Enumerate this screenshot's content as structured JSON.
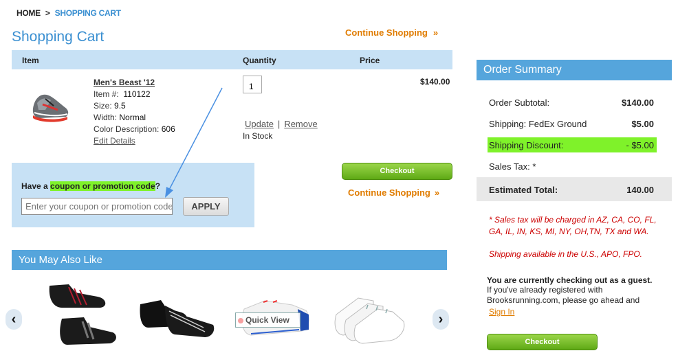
{
  "breadcrumb": {
    "home": "HOME",
    "sep": ">",
    "current": "SHOPPING CART"
  },
  "page": {
    "title": "Shopping Cart",
    "continue_top": "Continue Shopping",
    "arrow": "»"
  },
  "table": {
    "col_item": "Item",
    "col_quantity": "Quantity",
    "col_price": "Price"
  },
  "product": {
    "name": "Men's Beast '12",
    "item_label": "Item #:",
    "item_value": "110122",
    "size_label": "Size:",
    "size_value": "9.5",
    "width_label": "Width:",
    "width_value": "Normal",
    "color_label": "Color Description:",
    "color_value": "606",
    "edit_link": "Edit Details",
    "quantity": "1",
    "update_link": "Update",
    "separator": "|",
    "remove_link": "Remove",
    "stock": "In Stock",
    "price": "$140.00"
  },
  "coupon": {
    "question_prefix": "Have a ",
    "question_highlight": "coupon or promotion code",
    "question_suffix": "?",
    "placeholder": "Enter your coupon or promotion code",
    "apply_label": "APPLY"
  },
  "actions": {
    "checkout_label": "Checkout",
    "continue_mid": "Continue Shopping"
  },
  "recommendations": {
    "title": "You May Also Like",
    "quick_view": "Quick View",
    "prev": "‹",
    "next": "›"
  },
  "summary": {
    "title": "Order Summary",
    "subtotal_label": "Order Subtotal:",
    "subtotal_value": "$140.00",
    "shipping_label": "Shipping: FedEx Ground",
    "shipping_value": "$5.00",
    "discount_label": "Shipping Discount:",
    "discount_value": "- $5.00",
    "tax_label": "Sales Tax: *",
    "total_label": "Estimated Total:",
    "total_value": "140.00",
    "tax_note": "* Sales tax will be charged in AZ, CA, CO, FL, GA, IL, IN, KS, MI, NY, OH,TN, TX and WA.",
    "ship_note": "Shipping available in the U.S., APO, FPO.",
    "guest_head": "You are currently checking out as a guest.",
    "guest_text": "If you've already registered with Brooksrunning.com, please go ahead and",
    "signin_link": "Sign In",
    "checkout_label": "Checkout"
  },
  "colors": {
    "accent_blue": "#3a8fd1",
    "orange": "#e07c00",
    "highlight_green": "#7ff22a",
    "checkout_green": "#6cb520",
    "note_red": "#cc0000"
  }
}
